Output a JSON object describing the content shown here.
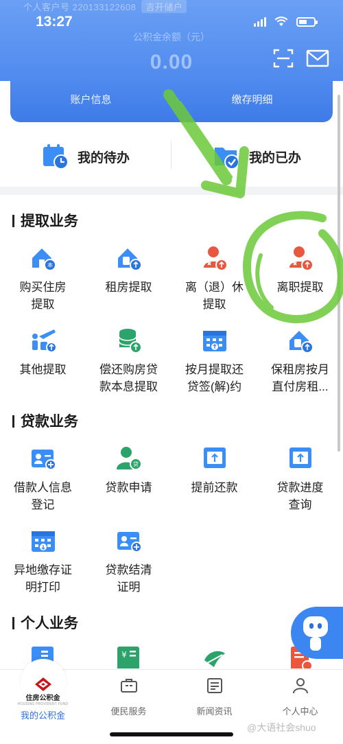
{
  "status_bar": {
    "time": "13:27"
  },
  "header": {
    "faded_account_text": "个人客户号 220133122608",
    "faded_tag": "吉开储户",
    "balance_label": "公积金余额（元）",
    "balance_value": "0.00",
    "icons": [
      "scan-icon",
      "mail-icon"
    ]
  },
  "account_tabs": [
    "账户信息",
    "缴存明细"
  ],
  "todo": {
    "pending": "我的待办",
    "done": "我的已办"
  },
  "sections": [
    {
      "title": "提取业务",
      "items": [
        {
          "label": "购买住房\n提取",
          "icon": "house-buy-icon"
        },
        {
          "label": "租房提取",
          "icon": "rent-icon"
        },
        {
          "label": "离（退）休\n提取",
          "icon": "retire-icon"
        },
        {
          "label": "离职提取",
          "icon": "resign-icon"
        },
        {
          "label": "其他提取",
          "icon": "travel-icon"
        },
        {
          "label": "偿还购房贷\n款本息提取",
          "icon": "coins-icon"
        },
        {
          "label": "按月提取还\n贷签(解)约",
          "icon": "calendar-icon"
        },
        {
          "label": "保租房按月\n直付房租...",
          "icon": "house-rent-icon"
        }
      ]
    },
    {
      "title": "贷款业务",
      "items": [
        {
          "label": "借款人信息\n登记",
          "icon": "borrower-icon"
        },
        {
          "label": "贷款申请",
          "icon": "loan-apply-icon"
        },
        {
          "label": "提前还款",
          "icon": "prepay-icon"
        },
        {
          "label": "贷款进度\n查询",
          "icon": "progress-icon"
        },
        {
          "label": "异地缴存证\n明打印",
          "icon": "print-icon"
        },
        {
          "label": "贷款结清\n证明",
          "icon": "settle-icon"
        }
      ]
    },
    {
      "title": "个人业务",
      "items": []
    }
  ],
  "tabbar": {
    "logo_text": "住房公积金",
    "logo_sub": "HOUSING PROVIDENT FUND",
    "tabs": [
      "我的公积金",
      "便民服务",
      "新闻资讯",
      "个人中心"
    ]
  },
  "watermark": "@大语社会shuo",
  "colors": {
    "primary_blue": "#3b86f0",
    "icon_blue": "#3a8ef6",
    "icon_red": "#e9573f",
    "icon_green": "#2ca36b",
    "annotation_green": "#6cc93a"
  }
}
